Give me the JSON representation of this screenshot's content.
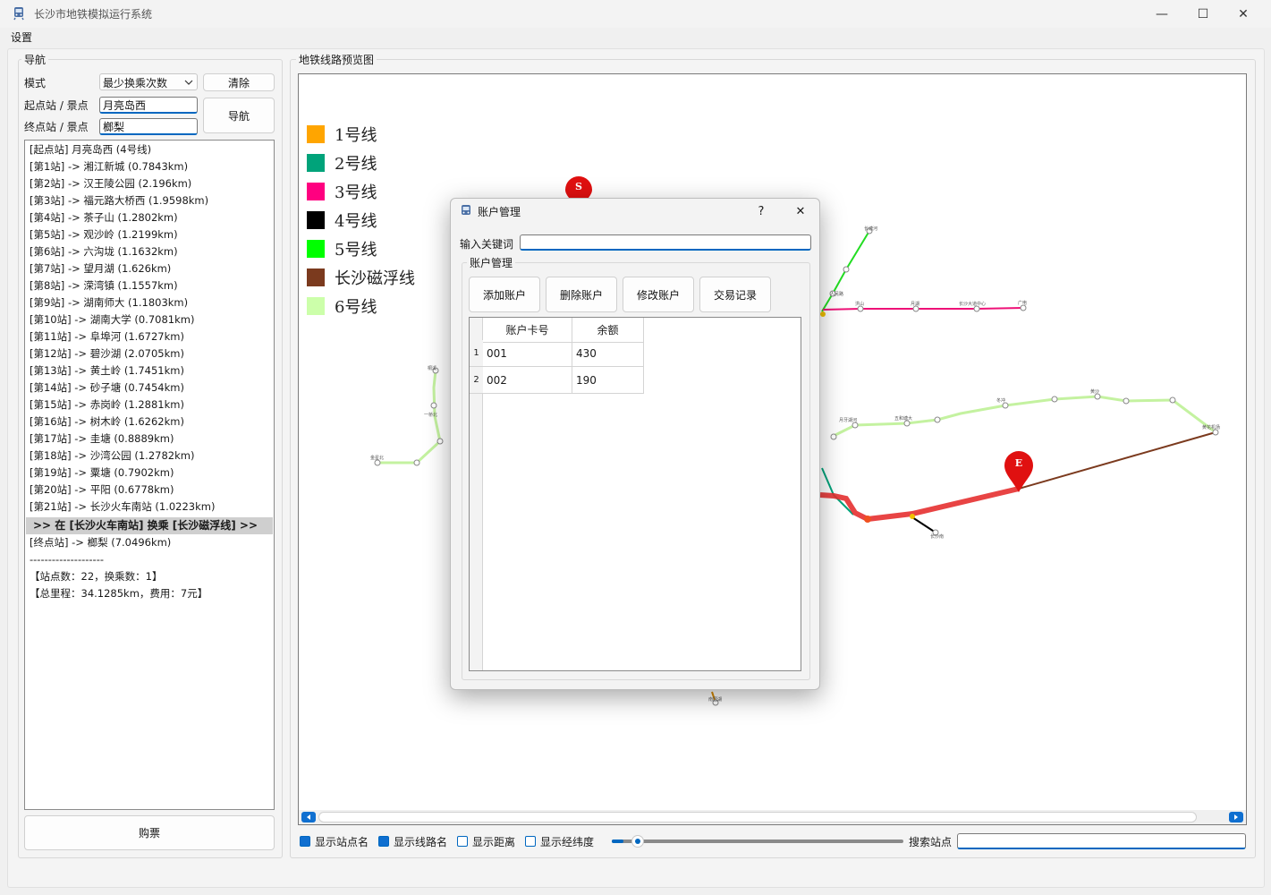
{
  "window": {
    "title": "长沙市地铁模拟运行系统",
    "minimize": "—",
    "maximize": "☐",
    "close": "✕"
  },
  "menu": {
    "settings": "设置"
  },
  "nav": {
    "group_title": "导航",
    "mode_label": "模式",
    "mode_value": "最少换乘次数",
    "clear_button": "清除",
    "start_label": "起点站 / 景点",
    "start_value": "月亮岛西",
    "end_label": "终点站 / 景点",
    "end_value": "榔梨",
    "navigate_button": "导航",
    "buy_button": "购票"
  },
  "route": {
    "lines": [
      "[起点站] 月亮岛西 (4号线)",
      "[第1站] -> 湘江新城 (0.7843km)",
      "[第2站] -> 汉王陵公园 (2.196km)",
      "[第3站] -> 福元路大桥西 (1.9598km)",
      "[第4站] -> 茶子山 (1.2802km)",
      "[第5站] -> 观沙岭 (1.2199km)",
      "[第6站] -> 六沟垅 (1.1632km)",
      "[第7站] -> 望月湖 (1.626km)",
      "[第8站] -> 溁湾镇 (1.1557km)",
      "[第9站] -> 湖南师大 (1.1803km)",
      "[第10站] -> 湖南大学 (0.7081km)",
      "[第11站] -> 阜埠河 (1.6727km)",
      "[第12站] -> 碧沙湖 (2.0705km)",
      "[第13站] -> 黄土岭 (1.7451km)",
      "[第14站] -> 砂子塘 (0.7454km)",
      "[第15站] -> 赤岗岭 (1.2881km)",
      "[第16站] -> 树木岭 (1.6262km)",
      "[第17站] -> 圭塘 (0.8889km)",
      "[第18站] -> 沙湾公园 (1.2782km)",
      "[第19站] -> 粟塘 (0.7902km)",
      "[第20站] -> 平阳 (0.6778km)",
      "[第21站] -> 长沙火车南站 (1.0223km)"
    ],
    "transfer": ">> 在 [长沙火车南站] 换乘 [长沙磁浮线] >>",
    "end_line": "[终点站] -> 榔梨 (7.0496km)",
    "separator": "--------------------",
    "summary1": "【站点数：22，换乘数：1】",
    "summary2": "【总里程：34.1285km，费用：7元】"
  },
  "map": {
    "group_title": "地铁线路预览图",
    "legend": [
      {
        "label": "1号线",
        "color": "#ffa500"
      },
      {
        "label": "2号线",
        "color": "#00a37a"
      },
      {
        "label": "3号线",
        "color": "#ff0080"
      },
      {
        "label": "4号线",
        "color": "#000000"
      },
      {
        "label": "5号线",
        "color": "#00ff00"
      },
      {
        "label": "长沙磁浮线",
        "color": "#7b3a1e"
      },
      {
        "label": "6号线",
        "color": "#ccffaa"
      }
    ],
    "start_marker": "S",
    "end_marker": "E",
    "options": [
      {
        "label": "显示站点名",
        "checked": true
      },
      {
        "label": "显示线路名",
        "checked": true
      },
      {
        "label": "显示距离",
        "checked": false
      },
      {
        "label": "显示经纬度",
        "checked": false
      }
    ],
    "search_label": "搜索站点",
    "search_value": "",
    "zoom_level": 0.04
  },
  "dialog": {
    "title": "账户管理",
    "help": "?",
    "close": "✕",
    "keyword_label": "输入关键词",
    "keyword_value": "",
    "group_title": "账户管理",
    "buttons": [
      "添加账户",
      "删除账户",
      "修改账户",
      "交易记录"
    ],
    "columns": [
      "账户卡号",
      "余额"
    ],
    "rows": [
      {
        "index": "1",
        "card": "001",
        "balance": "430"
      },
      {
        "index": "2",
        "card": "002",
        "balance": "190"
      }
    ]
  },
  "colors": {
    "accent": "#0067c0",
    "route_highlight": "#e53030",
    "marker": "#e01010"
  }
}
